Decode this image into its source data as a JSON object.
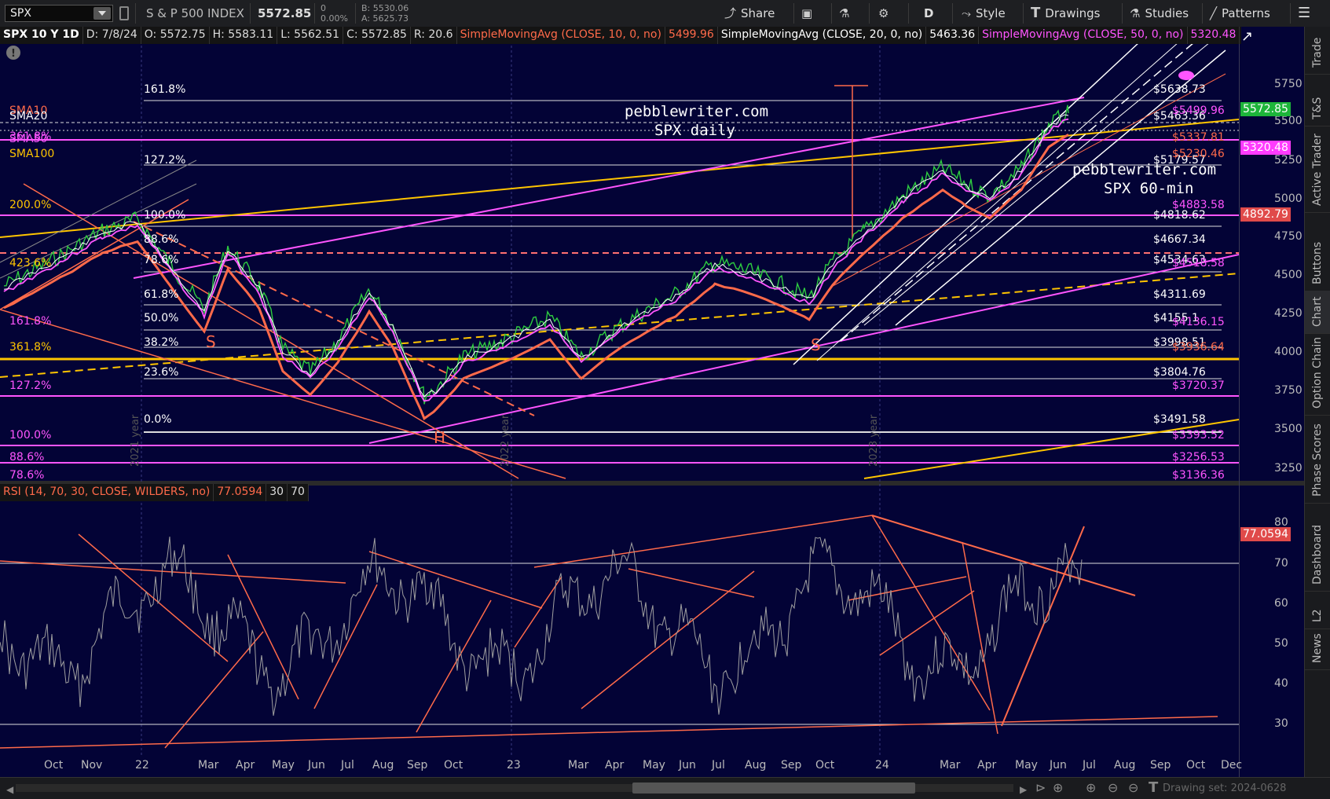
{
  "toolbar": {
    "symbol": "SPX",
    "description": "S & P 500 INDEX",
    "last": "5572.85",
    "change": "0",
    "change_pct": "0.00%",
    "bid": "B: 5530.06",
    "ask": "A: 5625.73",
    "share": "Share",
    "aggregation": "D",
    "style": "Style",
    "drawings": "Drawings",
    "studies": "Studies",
    "patterns": "Patterns"
  },
  "header": {
    "chart_id": "SPX 10 Y 1D",
    "date": "D: 7/8/24",
    "open": "O: 5572.75",
    "high": "H: 5583.11",
    "low": "L: 5562.51",
    "close": "C: 5572.85",
    "range": "R: 20.6",
    "sma10_label": "SimpleMovingAvg (CLOSE, 10, 0, no)",
    "sma10_value": "5499.96",
    "sma20_label": "SimpleMovingAvg (CLOSE, 20, 0, no)",
    "sma20_value": "5463.36",
    "sma50_label": "SimpleMovingAvg (CLOSE, 50, 0, no)",
    "sma50_value": "5320.48"
  },
  "rsi_header": {
    "label": "RSI (14, 70, 30, CLOSE, WILDERS, no)",
    "value": "77.0594",
    "oversold": "30",
    "overbought": "70"
  },
  "price_axis": [
    "5750",
    "5500",
    "5250",
    "5000",
    "4750",
    "4500",
    "4250",
    "4000",
    "3750",
    "3500",
    "3250"
  ],
  "rsi_axis": [
    "80",
    "70",
    "60",
    "50",
    "40",
    "30"
  ],
  "time_axis": [
    "Oct",
    "Nov",
    "22",
    "Mar",
    "Apr",
    "May",
    "Jun",
    "Jul",
    "Aug",
    "Sep",
    "Oct",
    "23",
    "Mar",
    "Apr",
    "May",
    "Jun",
    "Jul",
    "Aug",
    "Sep",
    "Oct",
    "24",
    "Mar",
    "Apr",
    "May",
    "Jun",
    "Jul",
    "Aug",
    "Sep",
    "Oct",
    "Dec"
  ],
  "price_tags": {
    "last": "5572.85",
    "sma50": "5320.48",
    "level": "4892.79",
    "rsi": "77.0594"
  },
  "fib_left": [
    "161.8%",
    "127.2%",
    "100.0%",
    "88.6%",
    "78.6%",
    "61.8%",
    "50.0%",
    "38.2%",
    "23.6%",
    "0.0%"
  ],
  "fib_right": [
    "$5638.73",
    "$5463.36",
    "$5179.57",
    "$4818.62",
    "$4667.34",
    "$4534.63",
    "$4311.69",
    "$4155.1",
    "$3998.51",
    "$3804.76",
    "$3491.58"
  ],
  "left_labels": [
    "SMA10",
    "SMA20",
    "361.8%",
    "SMA50",
    "SMA100",
    "200.0%",
    "423.6%",
    "161.8%",
    "361.8%",
    "127.2%",
    "100.0%",
    "88.6%",
    "78.6%"
  ],
  "right_pink_labels": [
    "$5499.96",
    "$5337.81",
    "$5230.46",
    "$4883.58",
    "$4518.58",
    "$4136.15",
    "$3936.64",
    "$3720.37",
    "$3393.52",
    "$3256.53",
    "$3136.36"
  ],
  "annotations": {
    "site1": "pebblewriter.com",
    "site1_sub": "SPX daily",
    "site2": "pebblewriter.com",
    "site2_sub": "SPX 60-min",
    "s1": "S",
    "s2": "S",
    "h": "H",
    "year2021": "2021 year",
    "year2022": "2022 year",
    "year2023": "2023 year"
  },
  "right_rail": [
    "Trade",
    "T&S",
    "Active Trader",
    "Buttons",
    "Chart",
    "Option Chain",
    "Phase Scores",
    "Dashboard",
    "L2",
    "News"
  ],
  "bottom": {
    "drawing_set": "Drawing set: 2024-0628"
  },
  "colors": {
    "background": "#030336",
    "candles": "#2ecc40",
    "sma_pink": "#ff55ff",
    "sma_orange": "#ff6a4a",
    "fib_yellow": "#ffc500",
    "last_tag": "#1db53a",
    "sma50_tag": "#ff3bff",
    "level_tag": "#e04a4a"
  }
}
